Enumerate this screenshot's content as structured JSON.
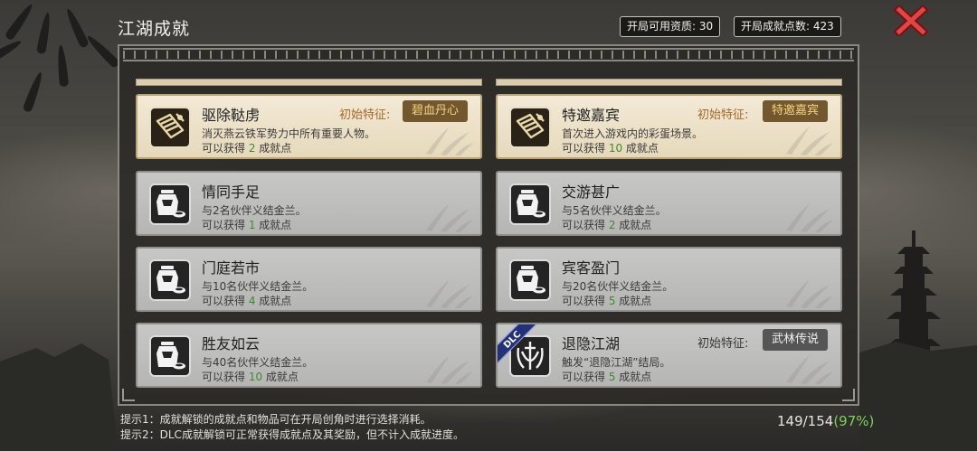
{
  "title": "江湖成就",
  "stats": {
    "resources_label": "开局可用资质:",
    "resources_value": "30",
    "points_label": "开局成就点数:",
    "points_value": "423"
  },
  "colors": {
    "reward_points": "#3d8a2e",
    "percent": "#7fd05c",
    "trait_gold": "#f3d27e",
    "dlc_ribbon": "#23307a"
  },
  "achievements": [
    {
      "title": "驱除鞑虏",
      "desc": "消灭燕云铁军势力中所有重要人物。",
      "reward_prefix": "可以获得 ",
      "points": "2",
      "reward_suffix": " 成就点",
      "trait_label": "初始特征:",
      "trait": "碧血丹心",
      "state": "unlocked",
      "icon": "scroll-brush-icon"
    },
    {
      "title": "特邀嘉宾",
      "desc": "首次进入游戏内的彩蛋场景。",
      "reward_prefix": "可以获得 ",
      "points": "10",
      "reward_suffix": " 成就点",
      "trait_label": "初始特征:",
      "trait": "特邀嘉宾",
      "state": "unlocked",
      "icon": "scroll-brush-icon"
    },
    {
      "title": "情同手足",
      "desc": "与2名伙伴义结金兰。",
      "reward_prefix": "可以获得 ",
      "points": "1",
      "reward_suffix": " 成就点",
      "state": "locked",
      "icon": "wine-jar-icon"
    },
    {
      "title": "交游甚广",
      "desc": "与5名伙伴义结金兰。",
      "reward_prefix": "可以获得 ",
      "points": "2",
      "reward_suffix": " 成就点",
      "state": "locked",
      "icon": "wine-jar-icon"
    },
    {
      "title": "门庭若市",
      "desc": "与10名伙伴义结金兰。",
      "reward_prefix": "可以获得 ",
      "points": "4",
      "reward_suffix": " 成就点",
      "state": "locked",
      "icon": "wine-jar-icon"
    },
    {
      "title": "宾客盈门",
      "desc": "与20名伙伴义结金兰。",
      "reward_prefix": "可以获得 ",
      "points": "5",
      "reward_suffix": " 成就点",
      "state": "locked",
      "icon": "wine-jar-icon"
    },
    {
      "title": "胜友如云",
      "desc": "与40名伙伴义结金兰。",
      "reward_prefix": "可以获得 ",
      "points": "10",
      "reward_suffix": " 成就点",
      "state": "locked",
      "icon": "wine-jar-icon"
    },
    {
      "title": "退隐江湖",
      "desc": "触发“退隐江湖”结局。",
      "reward_prefix": "可以获得 ",
      "points": "5",
      "reward_suffix": " 成就点",
      "trait_label": "初始特征:",
      "trait": "武林传说",
      "state": "locked",
      "dlc": "DLC",
      "icon": "sword-emblem-icon"
    }
  ],
  "hints": [
    "提示1：成就解锁的成就点和物品可在开局创角时进行选择消耗。",
    "提示2：DLC成就解锁可正常获得成就点及其奖励，但不计入成就进度。"
  ],
  "progress": {
    "text": "149/154",
    "percent": "(97%)"
  }
}
